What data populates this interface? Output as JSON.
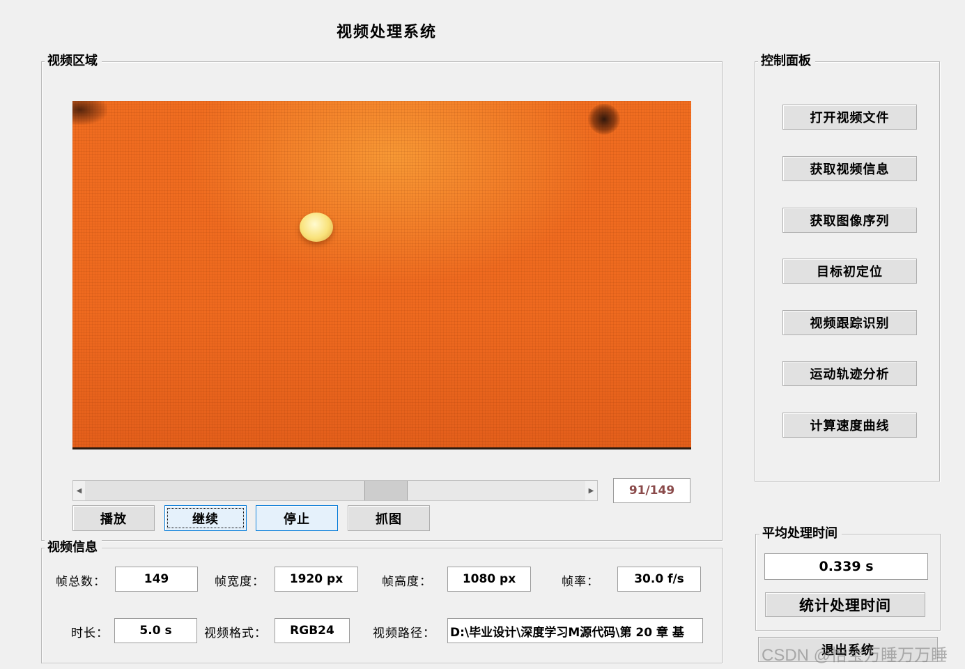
{
  "window": {
    "title": "视频处理系统"
  },
  "video_area": {
    "legend": "视频区域",
    "slider": {
      "value": 91,
      "max": 149
    },
    "frame_counter": "91/149",
    "buttons": {
      "play": "播放",
      "continue": "继续",
      "stop": "停止",
      "grab": "抓图"
    }
  },
  "video_info": {
    "legend": "视频信息",
    "total_frames": {
      "label": "帧总数：",
      "value": "149"
    },
    "frame_width": {
      "label": "帧宽度：",
      "value": "1920 px"
    },
    "frame_height": {
      "label": "帧高度：",
      "value": "1080 px"
    },
    "frame_rate": {
      "label": "帧率：",
      "value": "30.0 f/s"
    },
    "duration": {
      "label": "时长：",
      "value": "5.0 s"
    },
    "format": {
      "label": "视频格式：",
      "value": "RGB24"
    },
    "path": {
      "label": "视频路径：",
      "value": "D:\\毕业设计\\深度学习M源代码\\第 20 章 基"
    }
  },
  "control_panel": {
    "legend": "控制面板",
    "buttons": [
      "打开视频文件",
      "获取视频信息",
      "获取图像序列",
      "目标初定位",
      "视频跟踪识别",
      "运动轨迹分析",
      "计算速度曲线"
    ]
  },
  "timing": {
    "legend": "平均处理时间",
    "value": "0.339 s",
    "button": "统计处理时间"
  },
  "exit_button": "退出系统",
  "watermark": "CSDN @怡宝万睡万万睡",
  "colors": {
    "accent": "#0078d7",
    "counter_text": "#8a4a4a",
    "video_bg": "#ef6a1f"
  }
}
